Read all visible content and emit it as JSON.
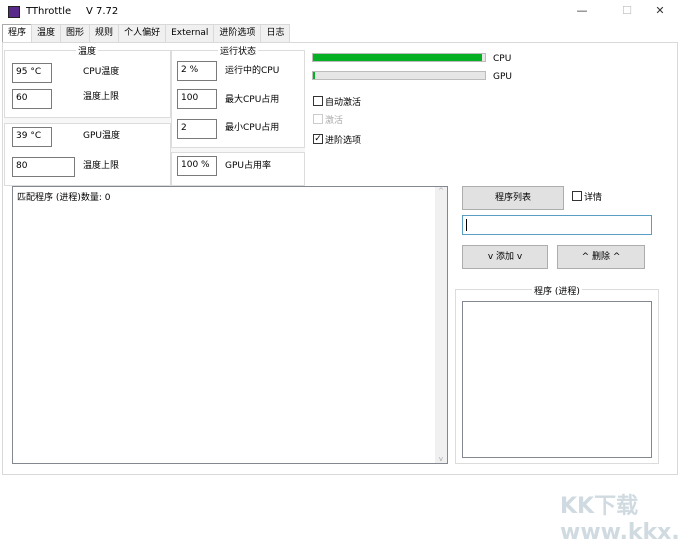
{
  "window": {
    "title": "TThrottle",
    "version": "V 7.72"
  },
  "tabs": [
    "程序",
    "温度",
    "图形",
    "规则",
    "个人偏好",
    "External",
    "进阶选项",
    "日志"
  ],
  "temperature": {
    "title": "温度",
    "cpu_temp": "95 °C",
    "cpu_temp_label": "CPU温度",
    "cpu_limit": "60",
    "cpu_limit_label": "温度上限",
    "gpu_temp": "39 °C",
    "gpu_temp_label": "GPU温度",
    "gpu_limit": "80",
    "gpu_limit_label": "温度上限"
  },
  "status": {
    "title": "运行状态",
    "running_cpu": "2 %",
    "running_cpu_label": "运行中的CPU",
    "max_cpu": "100",
    "max_cpu_label": "最大CPU占用",
    "min_cpu": "2",
    "min_cpu_label": "最小CPU占用",
    "gpu_usage": "100 %",
    "gpu_usage_label": "GPU占用率"
  },
  "bars": {
    "cpu_label": "CPU",
    "cpu_percent": 98,
    "gpu_label": "GPU",
    "gpu_percent": 1
  },
  "checks": {
    "auto_activate": "自动激活",
    "activate": "激活",
    "advanced": "进阶选项",
    "details": "详情"
  },
  "matched": {
    "text": "匹配程序 (进程)数量: 0"
  },
  "buttons": {
    "program_list": "程序列表",
    "add": "v 添加 v",
    "delete": "^ 删除 ^"
  },
  "input": {
    "value": ""
  },
  "process_group": {
    "title": "程序 (进程)"
  },
  "watermark": "KK下载 www.kkx.net"
}
